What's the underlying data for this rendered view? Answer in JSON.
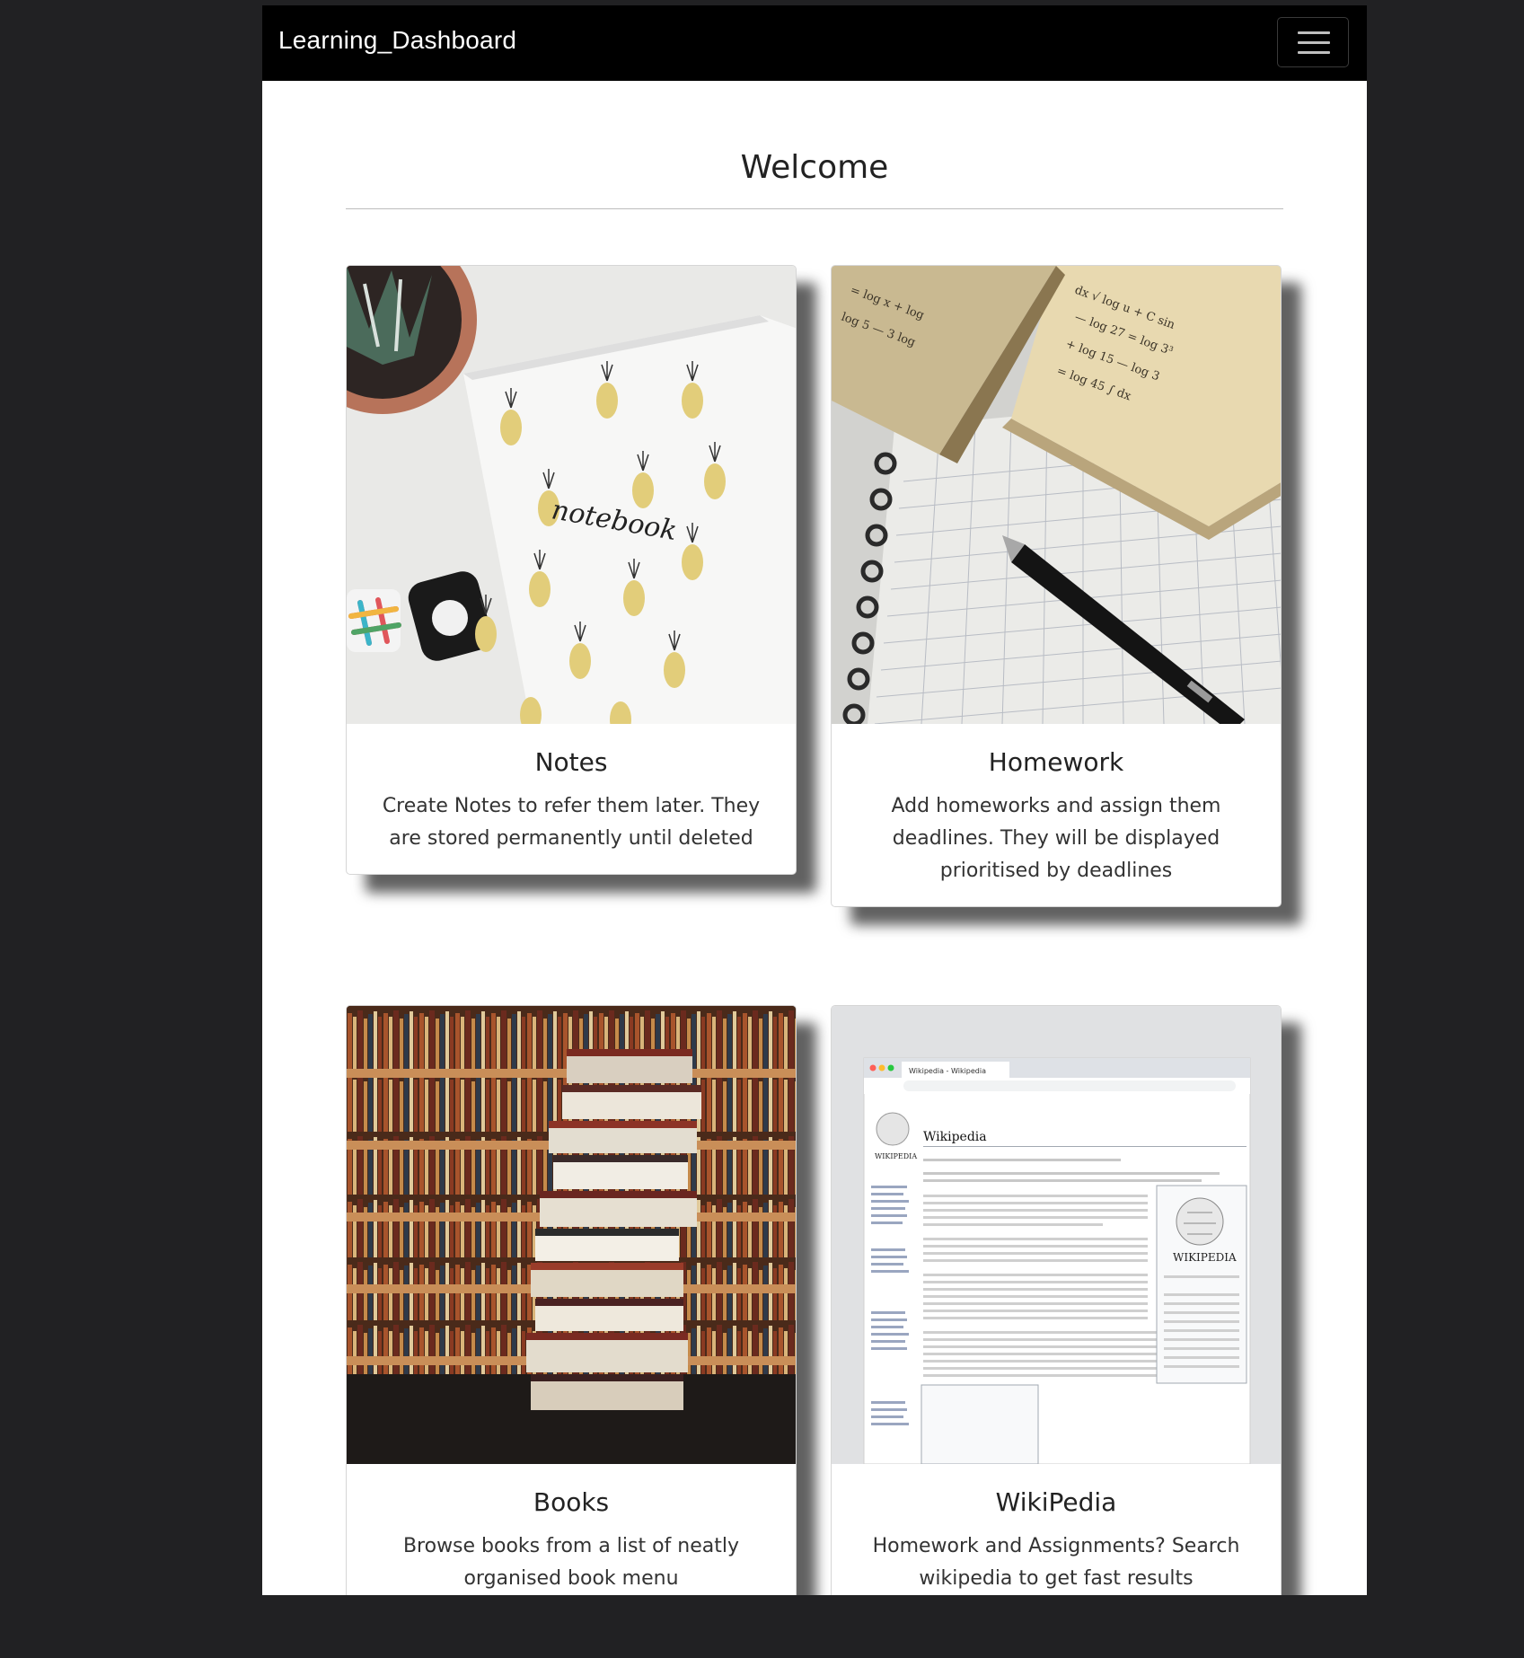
{
  "navbar": {
    "brand": "Learning_Dashboard",
    "menu_icon": "hamburger-icon"
  },
  "main": {
    "heading": "Welcome"
  },
  "cards": [
    {
      "title": "Notes",
      "description": "Create Notes to refer them later. They are stored permanently until deleted",
      "image": "notebook-photo",
      "notebook_text": "notebook"
    },
    {
      "title": "Homework",
      "description": "Add homeworks and assign them deadlines. They will be displayed prioritised by deadlines",
      "image": "book-and-pen-photo"
    },
    {
      "title": "Books",
      "description": "Browse books from a list of neatly organised book menu",
      "image": "book-stack-photo"
    },
    {
      "title": "WikiPedia",
      "description": "Homework and Assignments? Search wikipedia to get fast results",
      "image": "wikipedia-screenshot",
      "wiki_title": "Wikipedia",
      "wiki_logo_text": "WIKIPEDIA",
      "wiki_tab": "Wikipedia - Wikipedia"
    }
  ],
  "colors": {
    "navbar": "#000000",
    "backdrop": "#212123",
    "page": "#ffffff"
  }
}
